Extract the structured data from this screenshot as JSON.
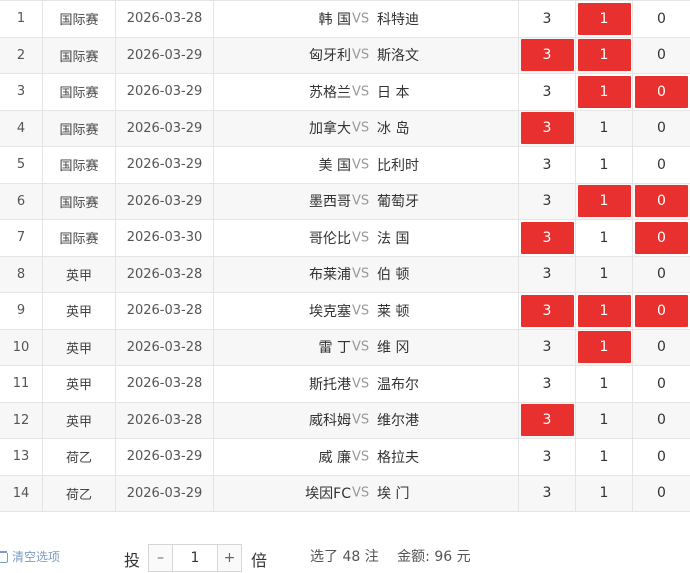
{
  "rows": [
    {
      "no": "1",
      "league": "国际赛",
      "date": "2026-03-28",
      "home": "韩 国",
      "away": "科特迪",
      "odds": [
        {
          "v": "3",
          "sel": false
        },
        {
          "v": "1",
          "sel": true
        },
        {
          "v": "0",
          "sel": false
        }
      ]
    },
    {
      "no": "2",
      "league": "国际赛",
      "date": "2026-03-29",
      "home": "匈牙利",
      "away": "斯洛文",
      "odds": [
        {
          "v": "3",
          "sel": true
        },
        {
          "v": "1",
          "sel": true
        },
        {
          "v": "0",
          "sel": false
        }
      ]
    },
    {
      "no": "3",
      "league": "国际赛",
      "date": "2026-03-29",
      "home": "苏格兰",
      "away": "日 本",
      "odds": [
        {
          "v": "3",
          "sel": false
        },
        {
          "v": "1",
          "sel": true
        },
        {
          "v": "0",
          "sel": true
        }
      ]
    },
    {
      "no": "4",
      "league": "国际赛",
      "date": "2026-03-29",
      "home": "加拿大",
      "away": "冰 岛",
      "odds": [
        {
          "v": "3",
          "sel": true
        },
        {
          "v": "1",
          "sel": false
        },
        {
          "v": "0",
          "sel": false
        }
      ]
    },
    {
      "no": "5",
      "league": "国际赛",
      "date": "2026-03-29",
      "home": "美 国",
      "away": "比利时",
      "odds": [
        {
          "v": "3",
          "sel": false
        },
        {
          "v": "1",
          "sel": false
        },
        {
          "v": "0",
          "sel": false
        }
      ]
    },
    {
      "no": "6",
      "league": "国际赛",
      "date": "2026-03-29",
      "home": "墨西哥",
      "away": "葡萄牙",
      "odds": [
        {
          "v": "3",
          "sel": false
        },
        {
          "v": "1",
          "sel": true
        },
        {
          "v": "0",
          "sel": true
        }
      ]
    },
    {
      "no": "7",
      "league": "国际赛",
      "date": "2026-03-30",
      "home": "哥伦比",
      "away": "法 国",
      "odds": [
        {
          "v": "3",
          "sel": true
        },
        {
          "v": "1",
          "sel": false
        },
        {
          "v": "0",
          "sel": true
        }
      ]
    },
    {
      "no": "8",
      "league": "英甲",
      "date": "2026-03-28",
      "home": "布莱浦",
      "away": "伯 顿",
      "odds": [
        {
          "v": "3",
          "sel": false
        },
        {
          "v": "1",
          "sel": false
        },
        {
          "v": "0",
          "sel": false
        }
      ]
    },
    {
      "no": "9",
      "league": "英甲",
      "date": "2026-03-28",
      "home": "埃克塞",
      "away": "莱 顿",
      "odds": [
        {
          "v": "3",
          "sel": true
        },
        {
          "v": "1",
          "sel": true
        },
        {
          "v": "0",
          "sel": true
        }
      ]
    },
    {
      "no": "10",
      "league": "英甲",
      "date": "2026-03-28",
      "home": "雷 丁",
      "away": "维 冈",
      "odds": [
        {
          "v": "3",
          "sel": false
        },
        {
          "v": "1",
          "sel": true
        },
        {
          "v": "0",
          "sel": false
        }
      ]
    },
    {
      "no": "11",
      "league": "英甲",
      "date": "2026-03-28",
      "home": "斯托港",
      "away": "温布尔",
      "odds": [
        {
          "v": "3",
          "sel": false
        },
        {
          "v": "1",
          "sel": false
        },
        {
          "v": "0",
          "sel": false
        }
      ]
    },
    {
      "no": "12",
      "league": "英甲",
      "date": "2026-03-28",
      "home": "威科姆",
      "away": "维尔港",
      "odds": [
        {
          "v": "3",
          "sel": true
        },
        {
          "v": "1",
          "sel": false
        },
        {
          "v": "0",
          "sel": false
        }
      ]
    },
    {
      "no": "13",
      "league": "荷乙",
      "date": "2026-03-29",
      "home": "威 廉",
      "away": "格拉夫",
      "odds": [
        {
          "v": "3",
          "sel": false
        },
        {
          "v": "1",
          "sel": false
        },
        {
          "v": "0",
          "sel": false
        }
      ]
    },
    {
      "no": "14",
      "league": "荷乙",
      "date": "2026-03-29",
      "home": "埃因FC",
      "away": "埃 门",
      "odds": [
        {
          "v": "3",
          "sel": false
        },
        {
          "v": "1",
          "sel": false
        },
        {
          "v": "0",
          "sel": false
        }
      ]
    }
  ],
  "vs_label": "VS",
  "footer": {
    "clear_label": "清空选项",
    "bet_label": "投",
    "minus": "–",
    "multiplier": "1",
    "plus": "+",
    "mult_label": "倍",
    "selected_text": "选了 48 注",
    "amount_text": "金额:  96 元"
  },
  "colors": {
    "selected_bg": "#e8312f",
    "alt_row_bg": "#f7f7f7",
    "clear_link": "#7a9cc6"
  }
}
